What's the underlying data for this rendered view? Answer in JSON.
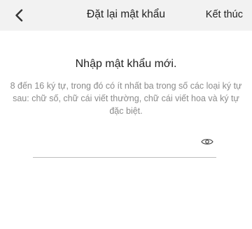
{
  "header": {
    "back_icon": "chevron-left-icon",
    "title": "Đặt lại mật khẩu",
    "done_label": "Kết thúc"
  },
  "main": {
    "heading": "Nhập mật khẩu mới.",
    "description": "8 đến 16 ký tự, trong đó có ít nhất ba trong số các loại ký tự sau: chữ số, chữ cái viết thường, chữ cái viết hoa và ký tự đặc biệt.",
    "password_field": {
      "value": "",
      "placeholder": "",
      "toggle_icon": "eye-icon"
    }
  }
}
